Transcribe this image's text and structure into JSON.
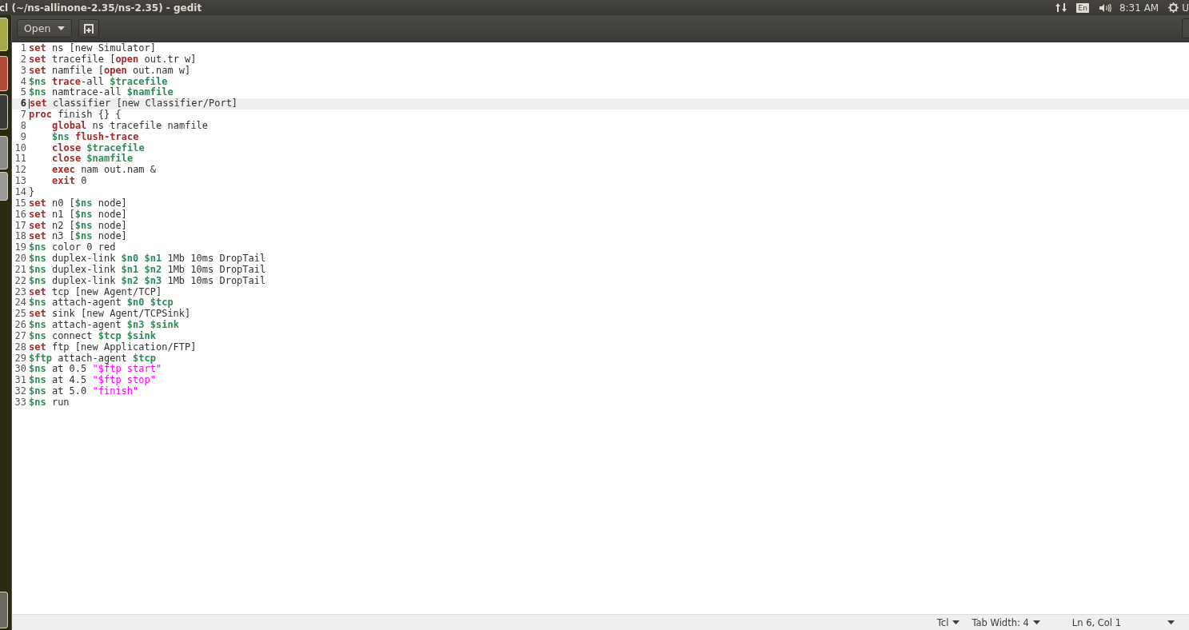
{
  "top_panel": {
    "window_title": "cl (~/ns-allinone-2.35/ns-2.35) - gedit",
    "keyboard_layout": "En",
    "clock": "8:31 AM",
    "user_menu": "U"
  },
  "toolbar": {
    "open_button": "Open"
  },
  "editor": {
    "lines": [
      {
        "number": "1",
        "selected": false,
        "indented": false,
        "tokens": [
          {
            "kind": "keyword",
            "text": "set "
          },
          {
            "kind": "plain",
            "text": "ns [new Simulator]"
          }
        ]
      },
      {
        "number": "2",
        "selected": false,
        "indented": false,
        "tokens": [
          {
            "kind": "keyword",
            "text": "set "
          },
          {
            "kind": "plain",
            "text": "tracefile ["
          },
          {
            "kind": "keyword",
            "text": "open"
          },
          {
            "kind": "plain",
            "text": " out.tr w]"
          }
        ]
      },
      {
        "number": "3",
        "selected": false,
        "indented": false,
        "tokens": [
          {
            "kind": "keyword",
            "text": "set "
          },
          {
            "kind": "plain",
            "text": "namfile ["
          },
          {
            "kind": "keyword",
            "text": "open"
          },
          {
            "kind": "plain",
            "text": " out.nam w]"
          }
        ]
      },
      {
        "number": "4",
        "selected": false,
        "indented": false,
        "tokens": [
          {
            "kind": "variable",
            "text": "$ns "
          },
          {
            "kind": "keyword",
            "text": "trace"
          },
          {
            "kind": "plain",
            "text": "-all "
          },
          {
            "kind": "variable",
            "text": "$tracefile"
          }
        ]
      },
      {
        "number": "5",
        "selected": false,
        "indented": false,
        "tokens": [
          {
            "kind": "variable",
            "text": "$ns "
          },
          {
            "kind": "plain",
            "text": "namtrace-all "
          },
          {
            "kind": "variable",
            "text": "$namfile"
          }
        ]
      },
      {
        "number": "6",
        "selected": true,
        "indented": false,
        "tokens": [
          {
            "kind": "keyword",
            "text": "set "
          },
          {
            "kind": "plain",
            "text": "classifier [new Classifier/Port]"
          }
        ]
      },
      {
        "number": "7",
        "selected": false,
        "indented": false,
        "tokens": [
          {
            "kind": "keyword",
            "text": "proc "
          },
          {
            "kind": "plain",
            "text": "finish {} {"
          }
        ]
      },
      {
        "number": "8",
        "selected": false,
        "indented": true,
        "tokens": [
          {
            "kind": "keyword",
            "text": "global "
          },
          {
            "kind": "plain",
            "text": "ns tracefile namfile"
          }
        ]
      },
      {
        "number": "9",
        "selected": false,
        "indented": true,
        "tokens": [
          {
            "kind": "variable",
            "text": "$ns "
          },
          {
            "kind": "keyword",
            "text": "flush-trace"
          }
        ]
      },
      {
        "number": "10",
        "selected": false,
        "indented": true,
        "tokens": [
          {
            "kind": "keyword",
            "text": "close "
          },
          {
            "kind": "variable",
            "text": "$tracefile"
          }
        ]
      },
      {
        "number": "11",
        "selected": false,
        "indented": true,
        "tokens": [
          {
            "kind": "keyword",
            "text": "close "
          },
          {
            "kind": "variable",
            "text": "$namfile"
          }
        ]
      },
      {
        "number": "12",
        "selected": false,
        "indented": true,
        "tokens": [
          {
            "kind": "keyword",
            "text": "exec "
          },
          {
            "kind": "plain",
            "text": "nam out.nam &"
          }
        ]
      },
      {
        "number": "13",
        "selected": false,
        "indented": true,
        "tokens": [
          {
            "kind": "keyword",
            "text": "exit "
          },
          {
            "kind": "plain",
            "text": "0"
          }
        ]
      },
      {
        "number": "14",
        "selected": false,
        "indented": false,
        "tokens": [
          {
            "kind": "plain",
            "text": "}"
          }
        ]
      },
      {
        "number": "15",
        "selected": false,
        "indented": false,
        "tokens": [
          {
            "kind": "keyword",
            "text": "set "
          },
          {
            "kind": "plain",
            "text": "n0 ["
          },
          {
            "kind": "variable",
            "text": "$ns "
          },
          {
            "kind": "plain",
            "text": "node]"
          }
        ]
      },
      {
        "number": "16",
        "selected": false,
        "indented": false,
        "tokens": [
          {
            "kind": "keyword",
            "text": "set "
          },
          {
            "kind": "plain",
            "text": "n1 ["
          },
          {
            "kind": "variable",
            "text": "$ns "
          },
          {
            "kind": "plain",
            "text": "node]"
          }
        ]
      },
      {
        "number": "17",
        "selected": false,
        "indented": false,
        "tokens": [
          {
            "kind": "keyword",
            "text": "set "
          },
          {
            "kind": "plain",
            "text": "n2 ["
          },
          {
            "kind": "variable",
            "text": "$ns "
          },
          {
            "kind": "plain",
            "text": "node]"
          }
        ]
      },
      {
        "number": "18",
        "selected": false,
        "indented": false,
        "tokens": [
          {
            "kind": "keyword",
            "text": "set "
          },
          {
            "kind": "plain",
            "text": "n3 ["
          },
          {
            "kind": "variable",
            "text": "$ns "
          },
          {
            "kind": "plain",
            "text": "node]"
          }
        ]
      },
      {
        "number": "19",
        "selected": false,
        "indented": false,
        "tokens": [
          {
            "kind": "variable",
            "text": "$ns "
          },
          {
            "kind": "plain",
            "text": "color 0 red"
          }
        ]
      },
      {
        "number": "20",
        "selected": false,
        "indented": false,
        "tokens": [
          {
            "kind": "variable",
            "text": "$ns "
          },
          {
            "kind": "plain",
            "text": "duplex-link "
          },
          {
            "kind": "variable",
            "text": "$n0 $n1 "
          },
          {
            "kind": "plain",
            "text": "1Mb 10ms DropTail"
          }
        ]
      },
      {
        "number": "21",
        "selected": false,
        "indented": false,
        "tokens": [
          {
            "kind": "variable",
            "text": "$ns "
          },
          {
            "kind": "plain",
            "text": "duplex-link "
          },
          {
            "kind": "variable",
            "text": "$n1 $n2 "
          },
          {
            "kind": "plain",
            "text": "1Mb 10ms DropTail"
          }
        ]
      },
      {
        "number": "22",
        "selected": false,
        "indented": false,
        "tokens": [
          {
            "kind": "variable",
            "text": "$ns "
          },
          {
            "kind": "plain",
            "text": "duplex-link "
          },
          {
            "kind": "variable",
            "text": "$n2 $n3 "
          },
          {
            "kind": "plain",
            "text": "1Mb 10ms DropTail"
          }
        ]
      },
      {
        "number": "23",
        "selected": false,
        "indented": false,
        "tokens": [
          {
            "kind": "keyword",
            "text": "set "
          },
          {
            "kind": "plain",
            "text": "tcp [new Agent/TCP]"
          }
        ]
      },
      {
        "number": "24",
        "selected": false,
        "indented": false,
        "tokens": [
          {
            "kind": "variable",
            "text": "$ns "
          },
          {
            "kind": "plain",
            "text": "attach-agent "
          },
          {
            "kind": "variable",
            "text": "$n0 $tcp"
          }
        ]
      },
      {
        "number": "25",
        "selected": false,
        "indented": false,
        "tokens": [
          {
            "kind": "keyword",
            "text": "set "
          },
          {
            "kind": "plain",
            "text": "sink [new Agent/TCPSink]"
          }
        ]
      },
      {
        "number": "26",
        "selected": false,
        "indented": false,
        "tokens": [
          {
            "kind": "variable",
            "text": "$ns "
          },
          {
            "kind": "plain",
            "text": "attach-agent "
          },
          {
            "kind": "variable",
            "text": "$n3 $sink"
          }
        ]
      },
      {
        "number": "27",
        "selected": false,
        "indented": false,
        "tokens": [
          {
            "kind": "variable",
            "text": "$ns "
          },
          {
            "kind": "plain",
            "text": "connect "
          },
          {
            "kind": "variable",
            "text": "$tcp $sink"
          }
        ]
      },
      {
        "number": "28",
        "selected": false,
        "indented": false,
        "tokens": [
          {
            "kind": "keyword",
            "text": "set "
          },
          {
            "kind": "plain",
            "text": "ftp [new Application/FTP]"
          }
        ]
      },
      {
        "number": "29",
        "selected": false,
        "indented": false,
        "tokens": [
          {
            "kind": "variable",
            "text": "$ftp "
          },
          {
            "kind": "plain",
            "text": "attach-agent "
          },
          {
            "kind": "variable",
            "text": "$tcp"
          }
        ]
      },
      {
        "number": "30",
        "selected": false,
        "indented": false,
        "tokens": [
          {
            "kind": "variable",
            "text": "$ns "
          },
          {
            "kind": "plain",
            "text": "at 0.5 "
          },
          {
            "kind": "string",
            "text": "\"$ftp start\""
          }
        ]
      },
      {
        "number": "31",
        "selected": false,
        "indented": false,
        "tokens": [
          {
            "kind": "variable",
            "text": "$ns "
          },
          {
            "kind": "plain",
            "text": "at 4.5 "
          },
          {
            "kind": "string",
            "text": "\"$ftp stop\""
          }
        ]
      },
      {
        "number": "32",
        "selected": false,
        "indented": false,
        "tokens": [
          {
            "kind": "variable",
            "text": "$ns "
          },
          {
            "kind": "plain",
            "text": "at 5.0 "
          },
          {
            "kind": "string",
            "text": "\"finish\""
          }
        ]
      },
      {
        "number": "33",
        "selected": false,
        "indented": false,
        "tokens": [
          {
            "kind": "variable",
            "text": "$ns "
          },
          {
            "kind": "plain",
            "text": "run"
          }
        ]
      }
    ]
  },
  "status_bar": {
    "language": "Tcl",
    "tab_width": "Tab Width: 4",
    "position": "Ln 6, Col 1"
  }
}
